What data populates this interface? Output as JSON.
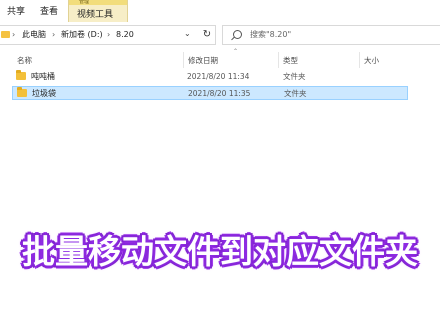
{
  "ribbon": {
    "tabs": [
      "共享",
      "查看"
    ],
    "context_group": "管理",
    "context_tab": "视频工具"
  },
  "address": {
    "crumbs": [
      "此电脑",
      "新加卷 (D:)",
      "8.20"
    ]
  },
  "search": {
    "placeholder": "搜索\"8.20\""
  },
  "columns": {
    "name": "名称",
    "date": "修改日期",
    "type": "类型",
    "size": "大小"
  },
  "files": [
    {
      "name": "吨吨桶",
      "date": "2021/8/20 11:34",
      "type": "文件夹"
    },
    {
      "name": "垃圾袋",
      "date": "2021/8/20 11:35",
      "type": "文件夹",
      "selected": true
    }
  ],
  "caption": "批量移动文件到对应文件夹",
  "colors": {
    "selection_bg": "#cce8ff",
    "selection_border": "#99d1ff",
    "context_tab_bg": "#f7eec7",
    "folder": "#f3c039",
    "caption_glow": "#8a2be2"
  },
  "icons": [
    "folder-icon",
    "search-icon",
    "refresh-icon",
    "chevron-down-icon",
    "chevron-right-icon"
  ]
}
